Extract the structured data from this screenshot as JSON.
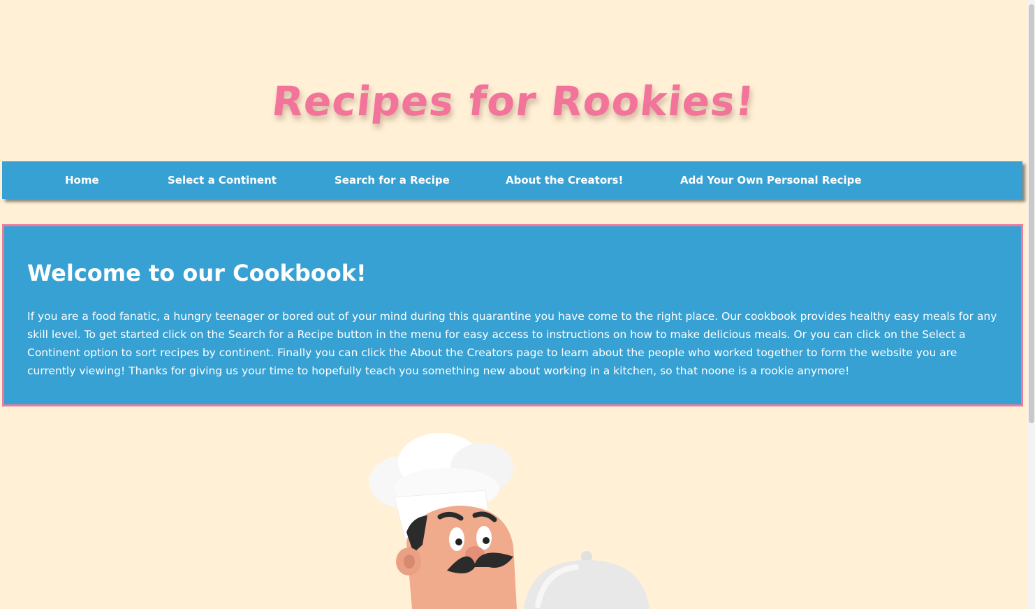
{
  "header": {
    "title": "Recipes for Rookies!"
  },
  "nav": {
    "items": [
      {
        "label": "Home"
      },
      {
        "label": "Select a Continent"
      },
      {
        "label": "Search for a Recipe"
      },
      {
        "label": "About the Creators!"
      },
      {
        "label": "Add Your Own Personal Recipe"
      }
    ]
  },
  "welcome": {
    "heading": "Welcome to our Cookbook!",
    "body": "If you are a food fanatic, a hungry teenager or bored out of your mind during this quarantine you have come to the right place. Our cookbook provides healthy easy meals for any skill level. To get started click on the Search for a Recipe button in the menu for easy access to instructions on how to make delicious meals. Or you can click on the Select a Continent option to sort recipes by continent. Finally you can click the About the Creators page to learn about the people who worked together to form the website you are currently viewing! Thanks for giving us your time to hopefully teach you something new about working in a kitchen, so that noone is a rookie anymore!"
  },
  "illustration": {
    "icon": "chef-illustration"
  },
  "colors": {
    "background": "#fff0d6",
    "nav": "#37a1d3",
    "title": "#f2749a",
    "border": "#f07a9b"
  }
}
